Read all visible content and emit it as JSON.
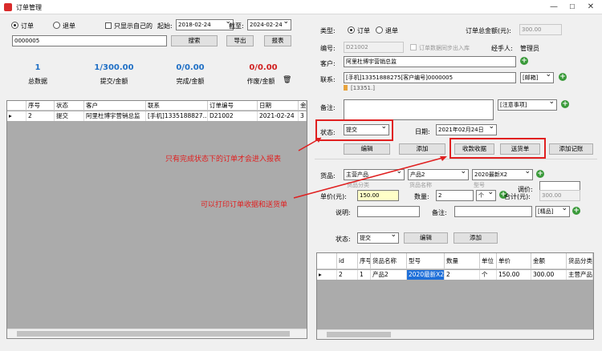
{
  "window": {
    "title": "订单管理",
    "min": "—",
    "max": "☐",
    "close": "✕"
  },
  "filter": {
    "radio_order": "订单",
    "radio_return": "退单",
    "only_mine": "只显示自己的",
    "start_label": "起始:",
    "start_date": "2018-02-24",
    "end_label": "截至:",
    "end_date": "2024-02-24",
    "search_value": "0000005",
    "search_btn": "搜索",
    "export_btn": "导出",
    "report_btn": "报表"
  },
  "stats": [
    {
      "value": "1",
      "label": "总数据",
      "color": "#1f6fc5"
    },
    {
      "value": "1/300.00",
      "label": "提交/金额",
      "color": "#1f6fc5"
    },
    {
      "value": "0/0.00",
      "label": "完成/金额",
      "color": "#1f6fc5"
    },
    {
      "value": "0/0.00",
      "label": "作废/金额",
      "color": "#d02020"
    }
  ],
  "orders_table": {
    "headers": [
      "序号",
      "状态",
      "客户",
      "联系",
      "订单编号",
      "日期",
      "金"
    ],
    "rows": [
      {
        "seq": "2",
        "status": "提交",
        "customer": "阿里杜博宇营销总监",
        "contact": "[手机]1335188827...",
        "order_no": "D21002",
        "date": "2021-02-24",
        "amount": "3"
      }
    ]
  },
  "form": {
    "type_label": "类型:",
    "type_order": "订单",
    "type_return": "退单",
    "total_label": "订单总金额(元):",
    "total_value": "300.00",
    "no_label": "编号:",
    "no_value": "D21002",
    "sync_label": "订单数据同步出入库",
    "manager_label": "经手人:",
    "manager_value": "管理员",
    "customer_label": "客户:",
    "customer_value": "阿里杜博宇营销总监",
    "contact_label": "联系:",
    "contact_value": "[手机]13351888275[客户编号]0000005",
    "contact_type": "[邮箱]",
    "contact_hint": "[13351.]",
    "remark_label": "备注:",
    "remark_type": "[注意事项]",
    "status_label": "状态:",
    "status_value": "提交",
    "date_label": "日期:",
    "date_value": "2021年02月24日",
    "edit_btn": "编辑",
    "add_btn": "添加",
    "receipt_btn": "收款收据",
    "delivery_btn": "送货单",
    "add_record_btn": "添加记账"
  },
  "item_form": {
    "product_label": "货品:",
    "category_value": "主营产品",
    "product_value": "产品2",
    "model_value": "2020最新X2",
    "category_hint": "货品分类",
    "name_hint": "货品名称",
    "model_hint": "型号",
    "adjust_label": "调价:",
    "price_label": "单价(元):",
    "price_value": "150.00",
    "qty_label": "数量:",
    "qty_value": "2",
    "unit_value": "个",
    "sum_label": "合计(元):",
    "sum_value": "300.00",
    "desc_label": "说明:",
    "note_label": "备注:",
    "grade_value": "[精品]",
    "status_label": "状态:",
    "status_value": "提交",
    "edit_btn": "编辑",
    "add_btn": "添加"
  },
  "items_table": {
    "headers": [
      "id",
      "序号",
      "货品名称",
      "型号",
      "数量",
      "单位",
      "单价",
      "金额",
      "货品分类"
    ],
    "rows": [
      {
        "id": "2",
        "seq": "1",
        "name": "产品2",
        "model": "2020最新X2",
        "qty": "2",
        "unit": "个",
        "price": "150.00",
        "amount": "300.00",
        "category": "主营产品"
      }
    ]
  },
  "annotations": {
    "a1": "只有完成状态下的订单才会进入报表",
    "a2": "可以打印订单收据和送货单"
  }
}
